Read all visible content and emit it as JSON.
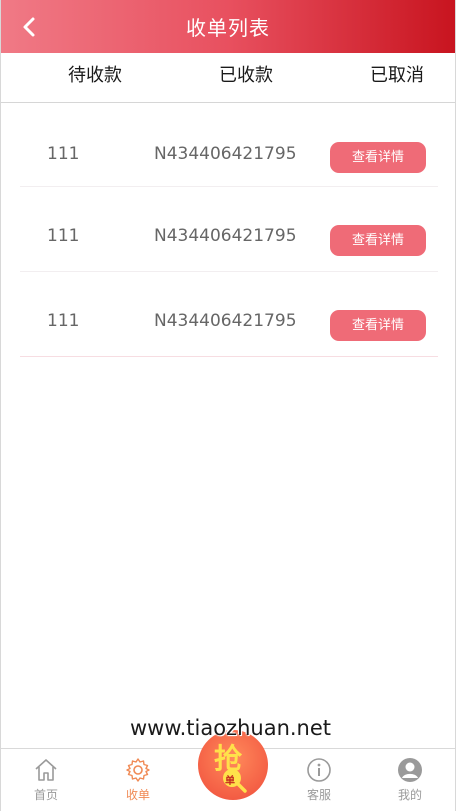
{
  "header": {
    "title": "收单列表",
    "back_icon": "chevron-left-icon"
  },
  "tabs": [
    {
      "label": "待收款"
    },
    {
      "label": "已收款"
    },
    {
      "label": "已取消"
    }
  ],
  "orders": [
    {
      "amount": "111",
      "order_no": "N434406421795",
      "action_label": "查看详情"
    },
    {
      "amount": "111",
      "order_no": "N434406421795",
      "action_label": "查看详情"
    },
    {
      "amount": "111",
      "order_no": "N434406421795",
      "action_label": "查看详情"
    }
  ],
  "watermark": "www.tiaozhuan.net",
  "bottom_nav": {
    "home": {
      "label": "首页",
      "icon": "home-icon"
    },
    "orders": {
      "label": "收单",
      "icon": "gear-icon"
    },
    "grab": {
      "label": "抢",
      "sublabel": "单",
      "icon": "magnifier-icon"
    },
    "service": {
      "label": "客服",
      "icon": "info-icon"
    },
    "mine": {
      "label": "我的",
      "icon": "user-icon"
    }
  },
  "colors": {
    "header_start": "#f07a86",
    "header_end": "#c8141f",
    "button": "#ef6b77",
    "active_nav": "#f08a55",
    "grab_button": "#f45f45",
    "grab_text": "#ffe14a"
  }
}
